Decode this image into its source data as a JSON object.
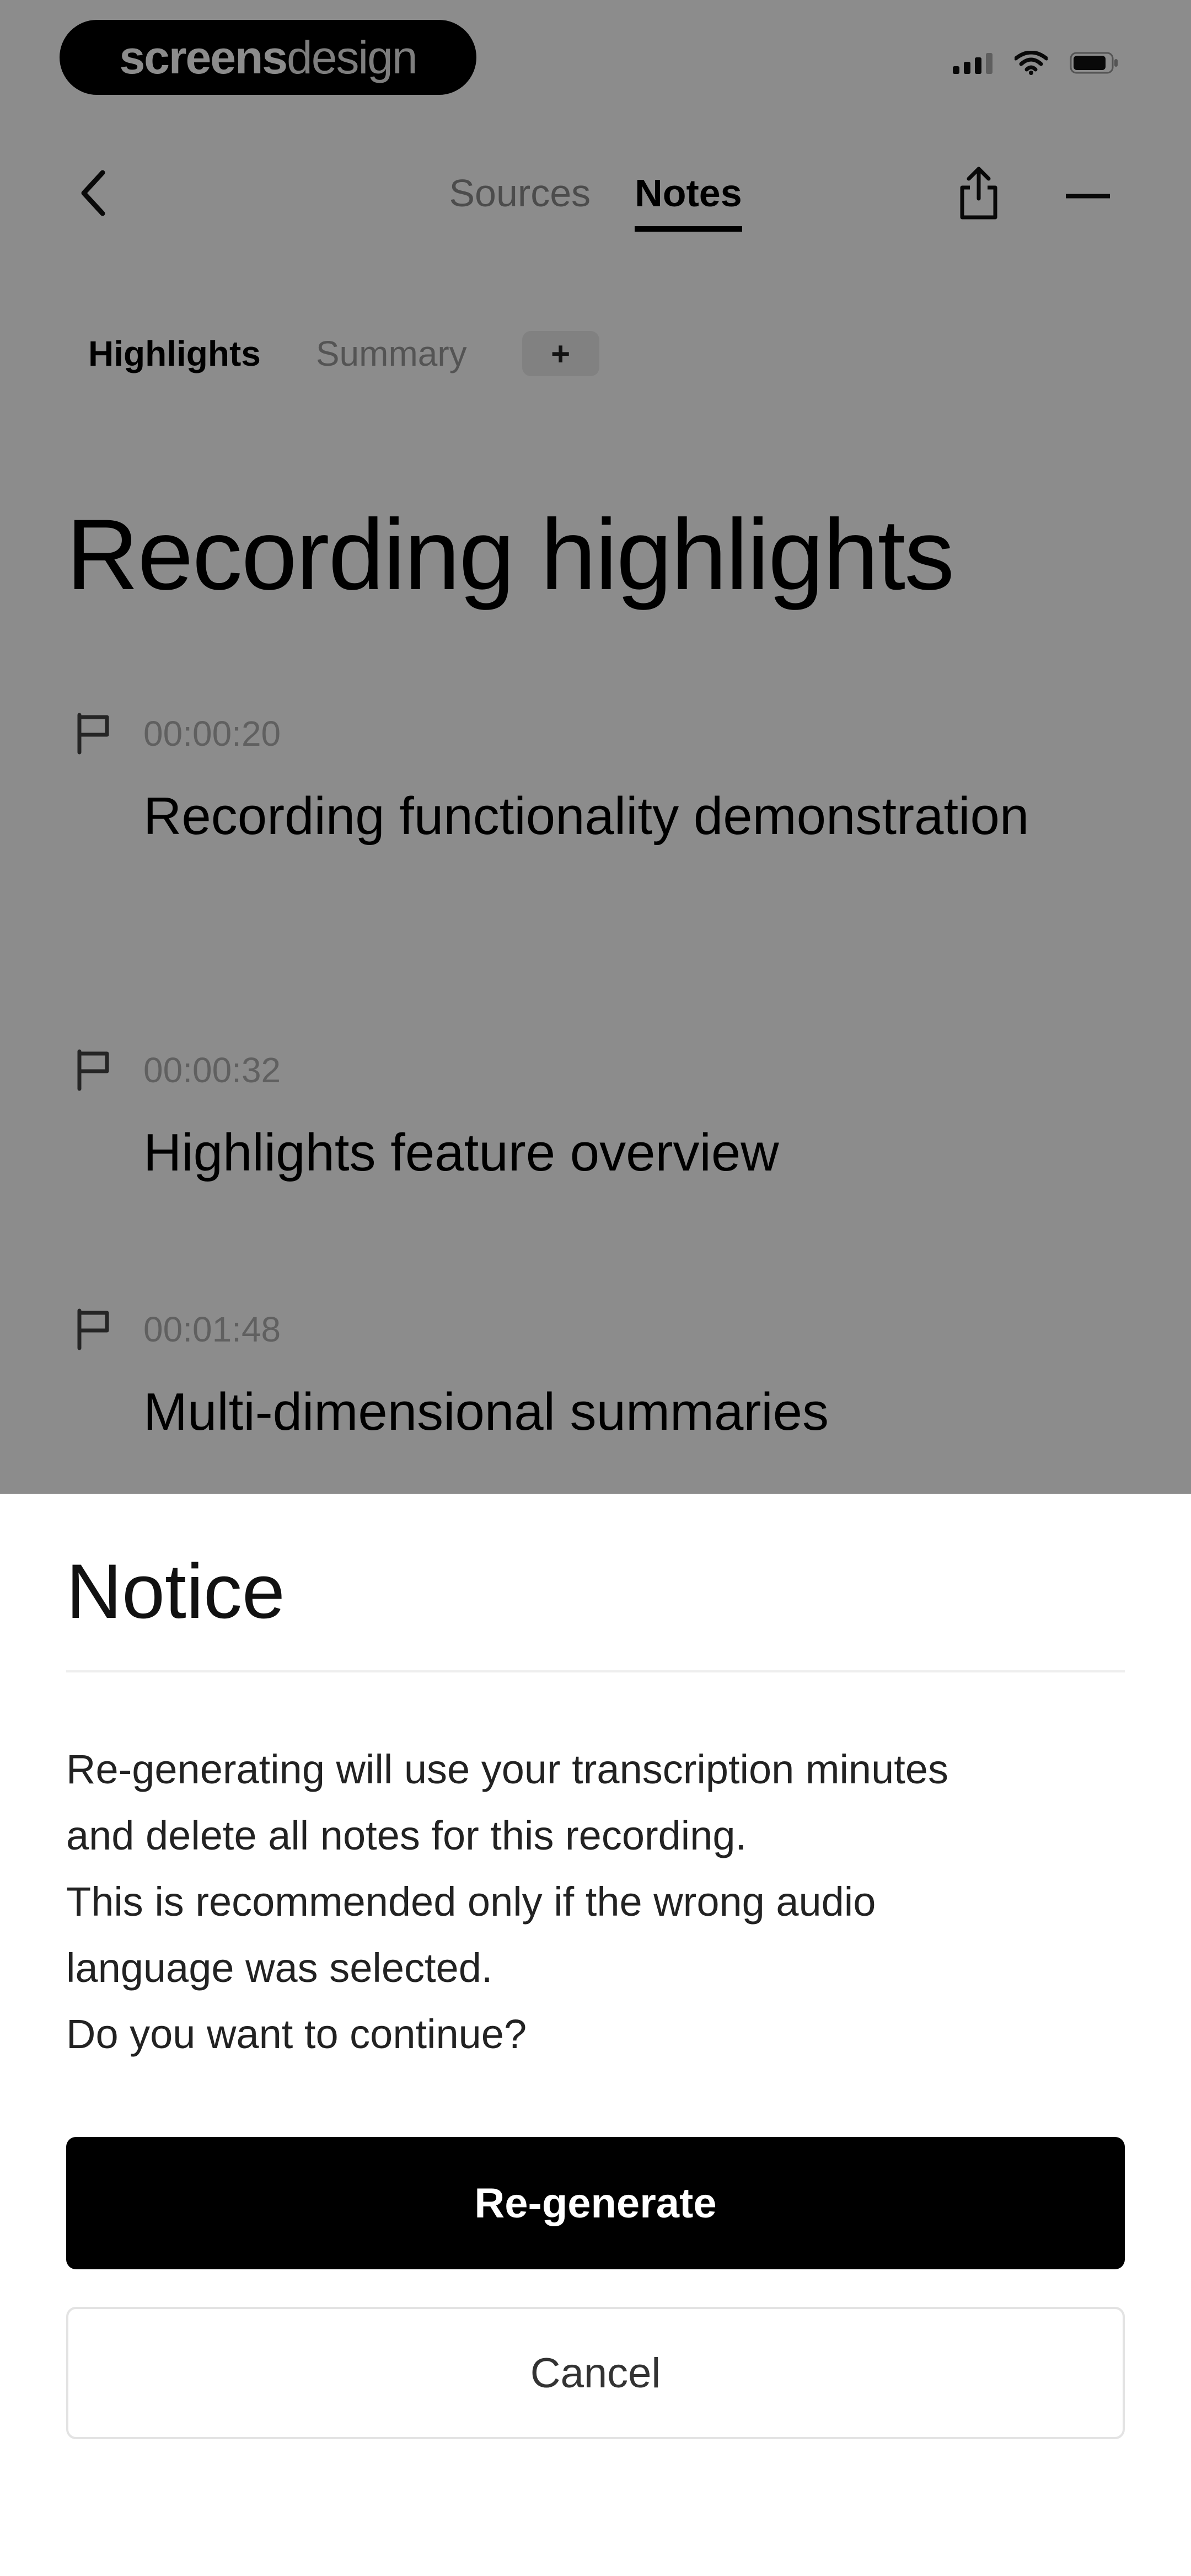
{
  "status_bar": {
    "brand_bold": "screens",
    "brand_light": "design",
    "icons": [
      "signal-icon",
      "wifi-icon",
      "battery-icon"
    ]
  },
  "nav": {
    "back_icon": "chevron-left-icon",
    "tabs": [
      {
        "label": "Sources",
        "active": false
      },
      {
        "label": "Notes",
        "active": true
      }
    ],
    "share_icon": "share-icon",
    "more_icon": "more-icon",
    "more_label": "—"
  },
  "sub_tabs": {
    "items": [
      {
        "label": "Highlights",
        "active": true
      },
      {
        "label": "Summary",
        "active": false
      }
    ],
    "add_label": "+"
  },
  "page": {
    "title": "Recording highlights"
  },
  "highlights": [
    {
      "time": "00:00:20",
      "title": "Recording functionality demonstration",
      "icon": "flag-icon"
    },
    {
      "time": "00:00:32",
      "title": "Highlights feature overview",
      "icon": "flag-icon"
    },
    {
      "time": "00:01:48",
      "title": "Multi-dimensional summaries",
      "icon": "flag-icon"
    }
  ],
  "dialog": {
    "title": "Notice",
    "body_lines": [
      "Re-generating will use your transcription minutes",
      "and delete all notes for this recording.",
      "This is recommended only if the wrong audio",
      "language was selected.",
      "Do you want to continue?"
    ],
    "primary_label": "Re-generate",
    "secondary_label": "Cancel"
  },
  "colors": {
    "primary": "#000000",
    "overlay": "rgba(0,0,0,0.45)",
    "muted_text": "#8a8a8a"
  }
}
